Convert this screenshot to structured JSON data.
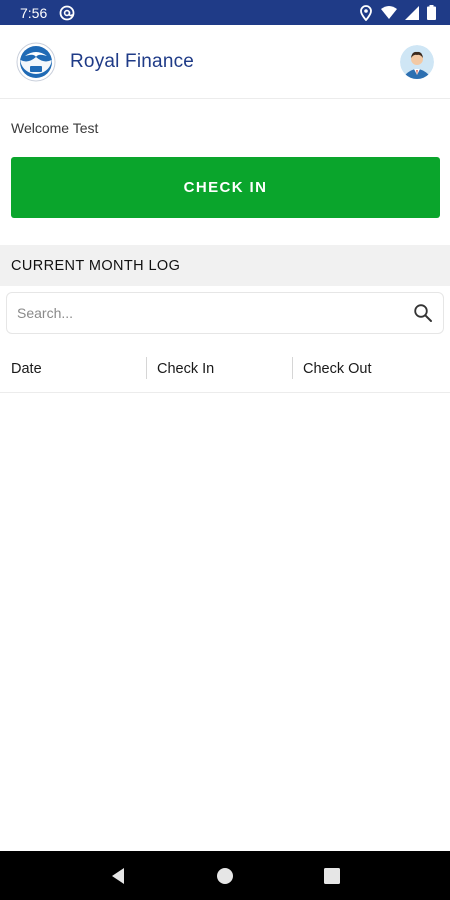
{
  "status_bar": {
    "time": "7:56",
    "icons": [
      "at-sign-icon",
      "location-icon",
      "wifi-icon",
      "signal-icon",
      "battery-icon"
    ]
  },
  "app_bar": {
    "title": "Royal Finance",
    "logo_icon": "noaa-emblem-icon",
    "avatar_icon": "user-avatar-icon"
  },
  "main": {
    "welcome_text": "Welcome Test",
    "check_in_label": "CHECK IN",
    "section_title": "CURRENT MONTH LOG",
    "search": {
      "placeholder": "Search...",
      "value": ""
    },
    "table": {
      "columns": [
        "Date",
        "Check In",
        "Check Out"
      ],
      "rows": []
    }
  },
  "nav_bar": {
    "icons": [
      "back-icon",
      "home-icon",
      "recents-icon"
    ]
  },
  "colors": {
    "status_bar": "#1f3b87",
    "brand_text": "#1f3b87",
    "check_in_button": "#0aa52c",
    "section_header_bg": "#f1f1f1",
    "nav_bar": "#000000"
  }
}
